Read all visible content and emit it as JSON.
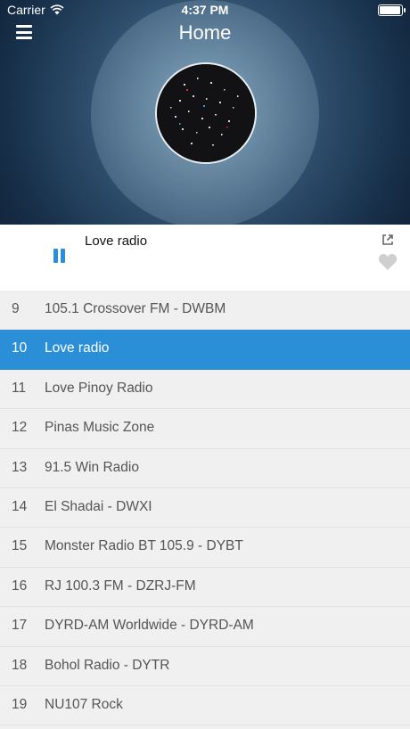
{
  "status": {
    "carrier": "Carrier",
    "time": "4:37 PM"
  },
  "header": {
    "title": "Home"
  },
  "player": {
    "now_playing": "Love radio",
    "state": "playing"
  },
  "colors": {
    "accent": "#2a8fd6",
    "list_bg": "#f0f0f0"
  },
  "icons": {
    "menu": "menu-icon",
    "pause": "pause-icon",
    "share": "share-icon",
    "favorite": "heart-icon"
  },
  "stations": [
    {
      "num": "9",
      "name": "105.1 Crossover FM - DWBM",
      "active": false
    },
    {
      "num": "10",
      "name": "Love radio",
      "active": true
    },
    {
      "num": "11",
      "name": "Love Pinoy Radio",
      "active": false
    },
    {
      "num": "12",
      "name": "Pinas Music Zone",
      "active": false
    },
    {
      "num": "13",
      "name": "91.5 Win Radio",
      "active": false
    },
    {
      "num": "14",
      "name": "El Shadai - DWXI",
      "active": false
    },
    {
      "num": "15",
      "name": "Monster Radio BT 105.9 - DYBT",
      "active": false
    },
    {
      "num": "16",
      "name": "RJ 100.3 FM - DZRJ-FM",
      "active": false
    },
    {
      "num": "17",
      "name": "DYRD-AM Worldwide - DYRD-AM",
      "active": false
    },
    {
      "num": "18",
      "name": "Bohol Radio - DYTR",
      "active": false
    },
    {
      "num": "19",
      "name": "NU107 Rock",
      "active": false
    }
  ]
}
